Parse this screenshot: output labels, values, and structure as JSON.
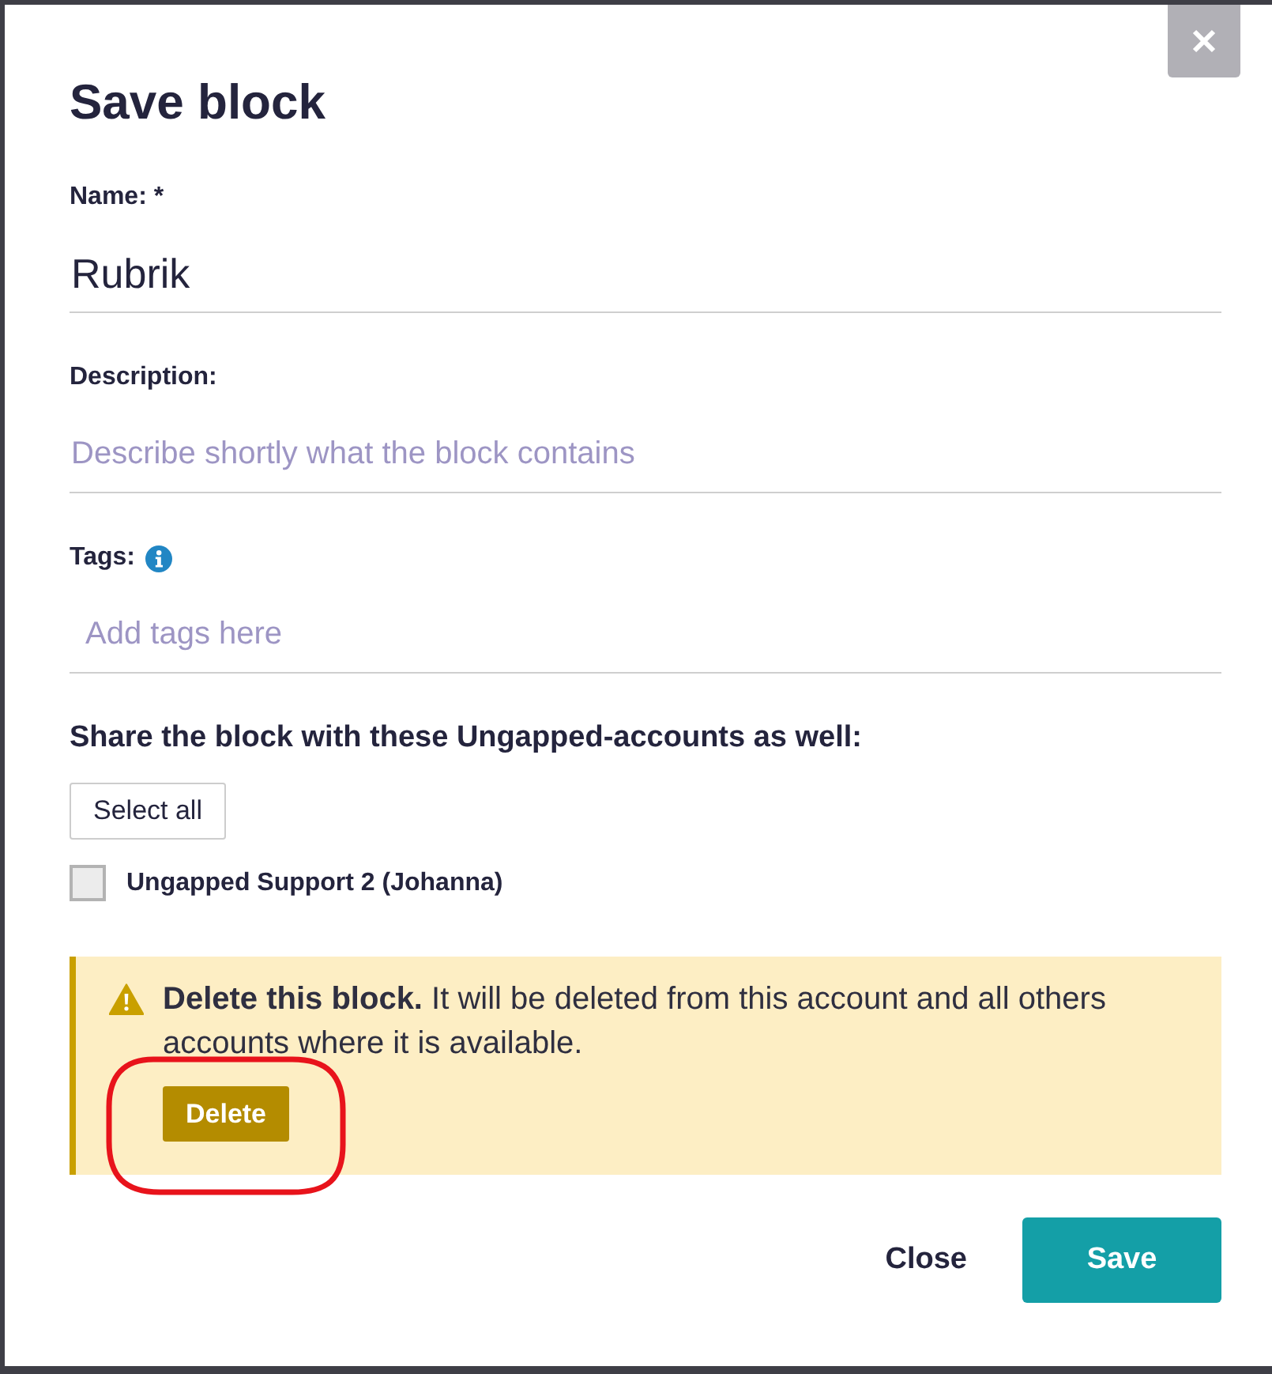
{
  "dialog": {
    "title": "Save block"
  },
  "fields": [
    {
      "kind": "text",
      "label": "Name: *",
      "value": "Rubrik"
    },
    {
      "kind": "text",
      "label": "Description:",
      "placeholder": "Describe shortly what the block contains"
    },
    {
      "kind": "tags",
      "label": "Tags:",
      "info": true,
      "placeholder": "Add tags here"
    }
  ],
  "sharing": {
    "heading": "Share the block with these Ungapped-accounts as well:",
    "select_all": "Select all",
    "accounts": [
      {
        "label": "Ungapped Support 2 (Johanna)",
        "checked": false
      }
    ]
  },
  "delete_section": {
    "message": "**Delete this block.** It will be deleted from this account and all others accounts where it is available.",
    "button": "Delete",
    "highlighted": true
  },
  "footer": {
    "buttons": [
      {
        "kind": "secondary",
        "label": "Close"
      },
      {
        "kind": "primary",
        "label": "Save"
      }
    ]
  }
}
